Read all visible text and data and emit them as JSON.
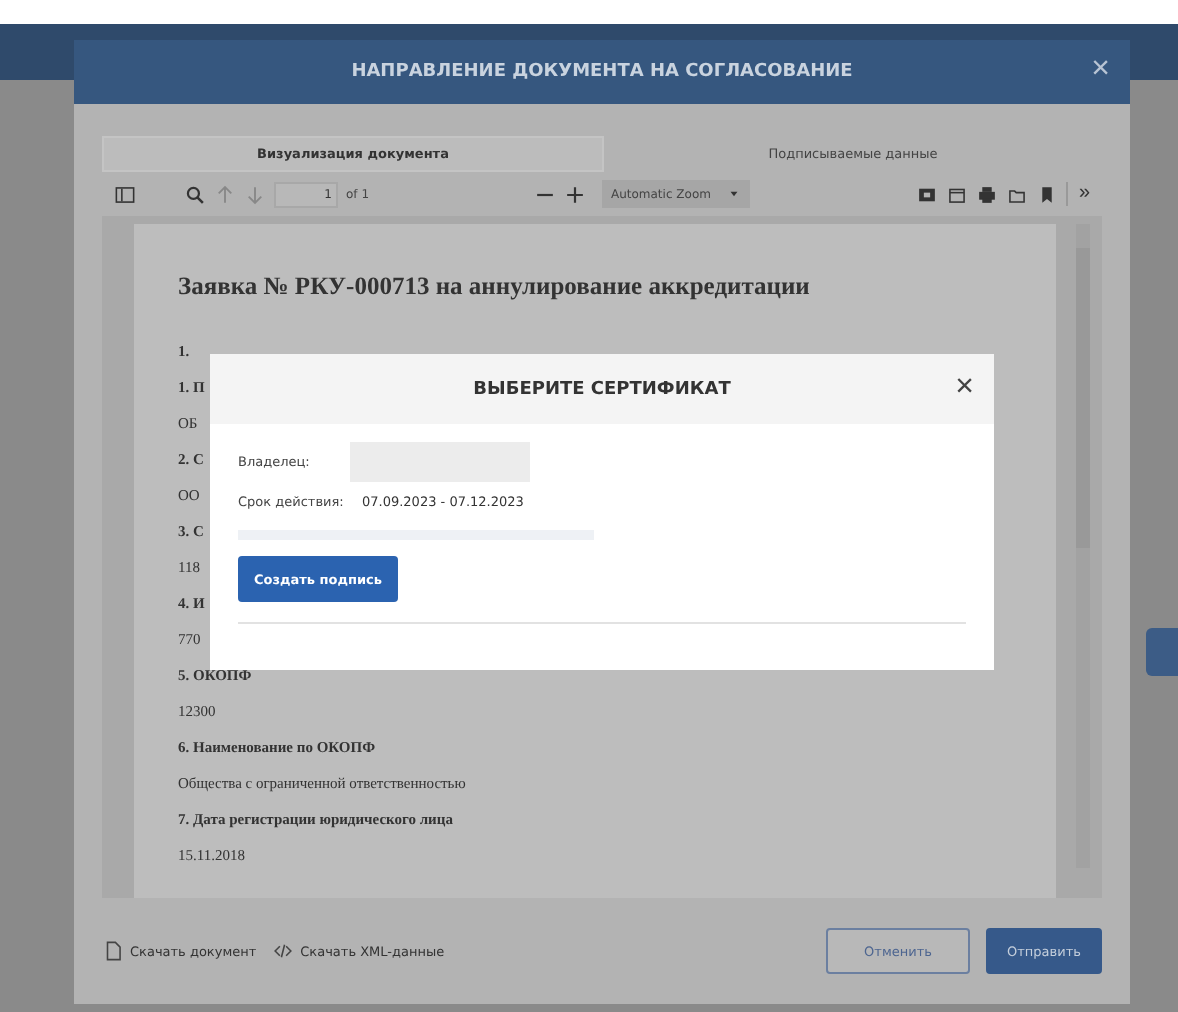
{
  "modal": {
    "title": "НАПРАВЛЕНИЕ ДОКУМЕНТА НА СОГЛАСОВАНИЕ",
    "close": "×",
    "tabs": [
      {
        "label": "Визуализация документа",
        "selected": true
      },
      {
        "label": "Подписываемые данные",
        "selected": false
      }
    ],
    "viewer_toolbar": {
      "page": "1",
      "page_count": "of 1",
      "zoom": "Automatic Zoom",
      "more": "»"
    },
    "document": {
      "title": "Заявка № РКУ-000713 на аннулирование аккредитации",
      "lines": [
        {
          "kind": "heading",
          "text": "1."
        },
        {
          "kind": "heading",
          "text": "1. П"
        },
        {
          "kind": "value",
          "text": "ОБ"
        },
        {
          "kind": "heading",
          "text": "2. С"
        },
        {
          "kind": "value",
          "text": "ОО"
        },
        {
          "kind": "heading",
          "text": "3. С"
        },
        {
          "kind": "value",
          "text": "118"
        },
        {
          "kind": "heading",
          "text": "4. И"
        },
        {
          "kind": "value",
          "text": "770"
        },
        {
          "kind": "heading",
          "text": "5. ОКОПФ"
        },
        {
          "kind": "value",
          "text": "12300"
        },
        {
          "kind": "heading",
          "text": "6. Наименование по ОКОПФ"
        },
        {
          "kind": "value",
          "text": "Общества с ограниченной ответственностью"
        },
        {
          "kind": "heading",
          "text": "7. Дата регистрации юридического лица"
        },
        {
          "kind": "value",
          "text": "15.11.2018"
        }
      ]
    },
    "links": [
      {
        "kind": "document",
        "label": "Скачать документ"
      },
      {
        "kind": "code",
        "label": "Скачать XML-данные"
      }
    ],
    "buttons": [
      {
        "kind": "secondary",
        "label": "Отменить"
      },
      {
        "kind": "primary",
        "label": "Отправить"
      }
    ]
  },
  "certificate_dialog": {
    "title": "ВЫБЕРИТЕ СЕРТИФИКАТ",
    "close": "×",
    "owner_label": "Владелец:",
    "validity_label": "Срок действия:",
    "validity": "07.09.2023 - 07.12.2023",
    "button": "Создать подпись"
  }
}
